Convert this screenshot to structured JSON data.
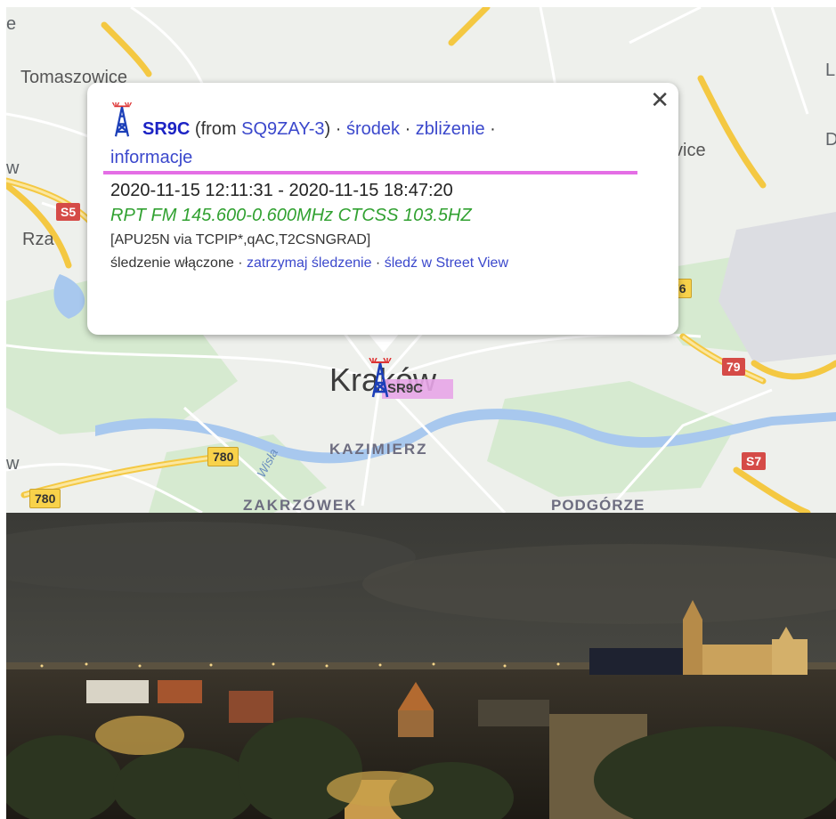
{
  "map": {
    "places": {
      "tomaszowice": "Tomaszowice",
      "left_w1": "w",
      "left_w2": "w",
      "rza": "Rza",
      "vice": "vice",
      "right_l": "L",
      "right_d": "D",
      "top_e": "e",
      "city": "Kraków",
      "kazimierz": "KAZIMIERZ",
      "zakrzowek": "ZAKRZÓWEK",
      "podgorze": "PODGÓRZE",
      "river": "Wisła"
    },
    "shields": {
      "s5": "S5",
      "s7": "S7",
      "r79": "79",
      "r76": "76",
      "r780a": "780",
      "r780b": "780"
    },
    "station_tag": "SR9C",
    "colors": {
      "road_yellow": "#f8d24a",
      "road_white": "#ffffff",
      "water": "#a8c8ee",
      "park": "#cde8c2",
      "background": "#eef0ec",
      "route_pink": "#e46ee5"
    }
  },
  "popup": {
    "callsign": "SR9C",
    "from_prefix": "(from ",
    "from_station": "SQ9ZAY-3",
    "from_suffix": ")",
    "sep": " · ",
    "center_link": "środek",
    "zoom_link": "zbliżenie",
    "info_link": "informacje",
    "date_range": "2020-11-15 12:11:31 - 2020-11-15 18:47:20",
    "comment": "RPT FM 145.600-0.600MHz CTCSS 103.5HZ",
    "path": "[APU25N via TCPIP*,qAC,T2CSNGRAD]",
    "tracking_status": "śledzenie włączone",
    "stop_tracking_link": "zatrzymaj śledzenie",
    "street_view_link": "śledź w Street View",
    "close_icon": "close-icon",
    "station_icon": "radio-tower-icon"
  },
  "photo": {
    "subject": "night-city-panorama"
  }
}
